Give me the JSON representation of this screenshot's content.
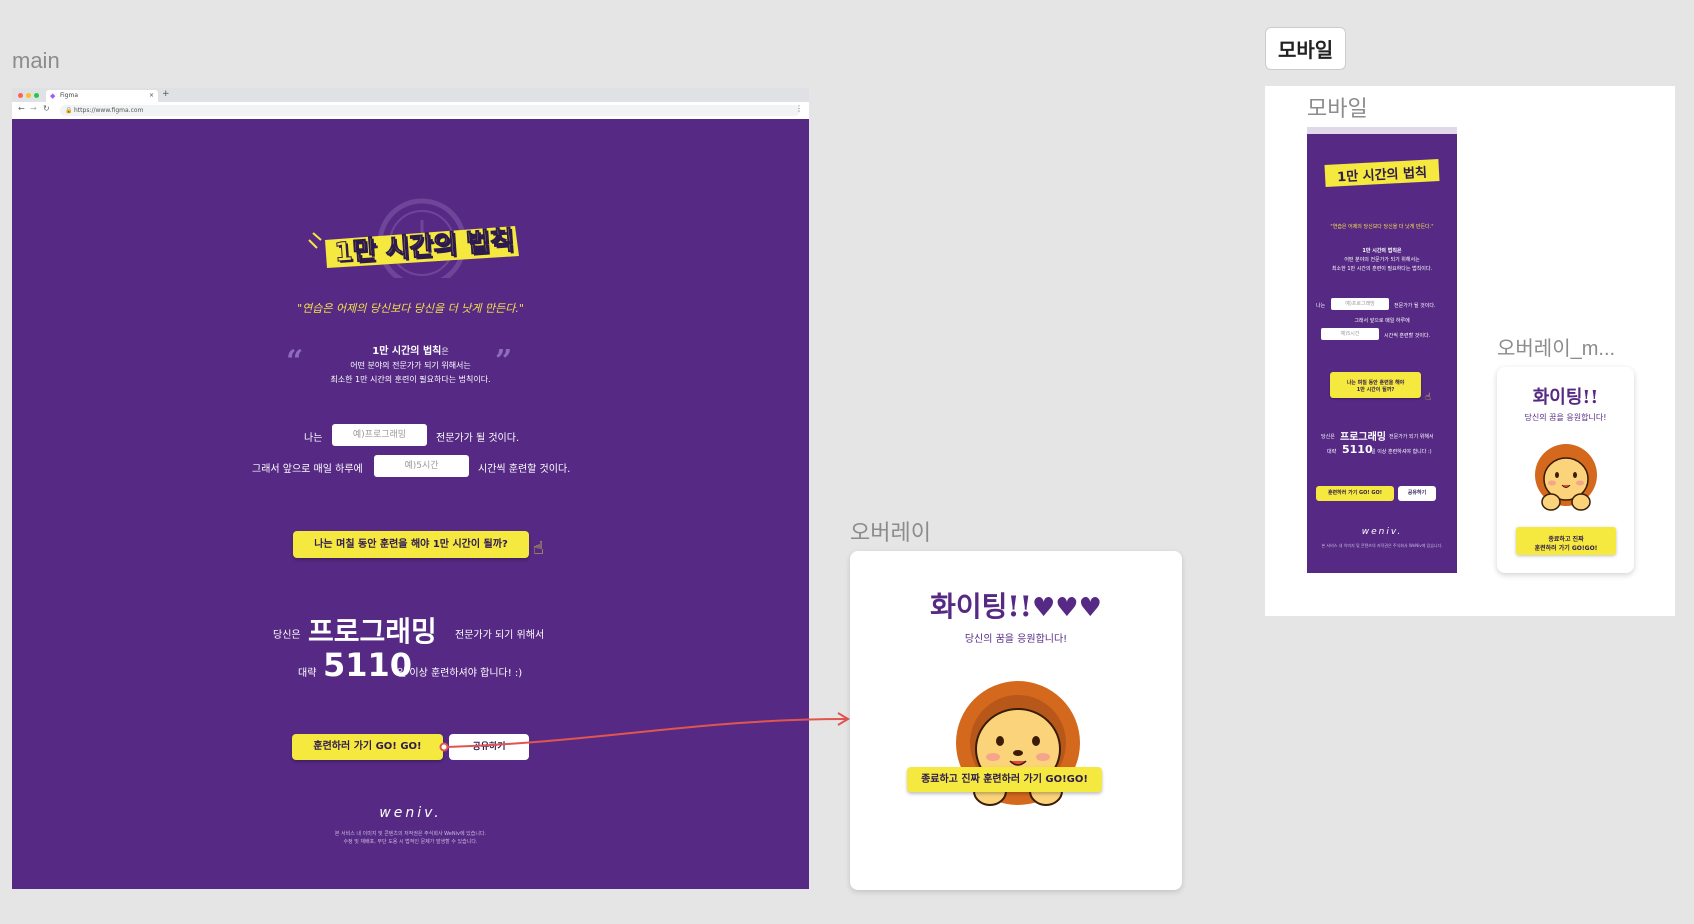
{
  "canvas": {
    "main_label": "main",
    "overlay_label": "오버레이",
    "mobile_section_button": "모바일",
    "mobile_label": "모바일",
    "overlay_m_label": "오버레이_m..."
  },
  "browser": {
    "tab_title": "Figma",
    "new_tab": "+",
    "url": "https://www.figma.com"
  },
  "main": {
    "title": "1만 시간의 법칙",
    "quote": "\"연습은 어제의 당신보다 당신을 더 낫게 만든다.\"",
    "rule_title": "1만 시간의 법칙",
    "rule_suffix": "은",
    "rule_line2": "어떤 분야의 전문가가 되기 위해서는",
    "rule_line3": "최소한 1만 시간의 훈련이 필요하다는 법칙이다.",
    "open_quote": "“",
    "close_quote": "”",
    "field_prefix": "나는",
    "field_placeholder": "예)프로그래밍",
    "field_suffix": "전문가가 될 것이다.",
    "time_prefix": "그래서 앞으로 매일 하루에",
    "time_placeholder": "예)5시간",
    "time_suffix": "시간씩 훈련할 것이다.",
    "calc_button": "나는 며칠 동안 훈련을 해야 1만 시간이 될까?",
    "result_prefix": "당신은",
    "result_field": "프로그래밍",
    "result_suffix": "전문가가 되기 위해서",
    "days_prefix": "대략",
    "days_value": "5110",
    "days_suffix": "일 이상 훈련하셔야 합니다! :)",
    "go_button": "훈련하러 가기 GO! GO!",
    "share_button": "공유하기",
    "logo": "weniv.",
    "footer_line1": "본 서비스 내 이미지 및 콘텐츠의 저작권은 주식회사 WeNiv에 있습니다.",
    "footer_line2": "수정 및 재배포, 무단 도용 시 법적인 문제가 발생할 수 있습니다."
  },
  "overlay": {
    "heading": "화이팅!!",
    "subheading": "당신의 꿈을 응원합니다!",
    "close_button": "종료하고 진짜 훈련하러 가기 GO!GO!"
  },
  "mobile": {
    "title": "1만 시간의 법칙",
    "quote": "\"연습은 어제의 당신보다 당신을 더 낫게 만든다.\"",
    "rule_title": "1만 시간의 법칙은",
    "rule_line2": "어떤 분야의 전문가가 되기 위해서는",
    "rule_line3": "최소한 1만 시간의 훈련이 필요하다는 법칙이다.",
    "field_prefix": "나는",
    "field_placeholder": "예)프로그래밍",
    "field_suffix": "전문가가 될 것이다.",
    "time_line": "그래서 앞으로 매일 하루에",
    "time_placeholder": "예)5시간",
    "time_suffix": "시간씩 훈련할 것이다.",
    "calc_button_line1": "나는 며칠 동안 훈련을 해야",
    "calc_button_line2": "1만 시간이 될까?",
    "result_prefix": "당신은",
    "result_field": "프로그래밍",
    "result_suffix": "전문가가 되기 위해서",
    "days_prefix": "대략",
    "days_value": "5110",
    "days_suffix": "일 이상 훈련하셔야 합니다 :)",
    "go_button": "훈련하러 가기 GO! GO!",
    "share_button": "공유하기",
    "logo": "weniv.",
    "footer": "본 서비스 내 이미지 및 콘텐츠의 저작권은 주식회사 WeNiv에 있습니다."
  },
  "overlay_m": {
    "heading": "화이팅!!",
    "subheading": "당신의 꿈을 응원합니다!",
    "close_button_line1": "종료하고 진짜",
    "close_button_line2": "훈련하러 가기 GO!GO!"
  },
  "colors": {
    "canvas": "#e5e5e5",
    "brand_purple": "#562a84",
    "accent_yellow": "#f5e83f",
    "arrow_red": "#e0554f"
  }
}
